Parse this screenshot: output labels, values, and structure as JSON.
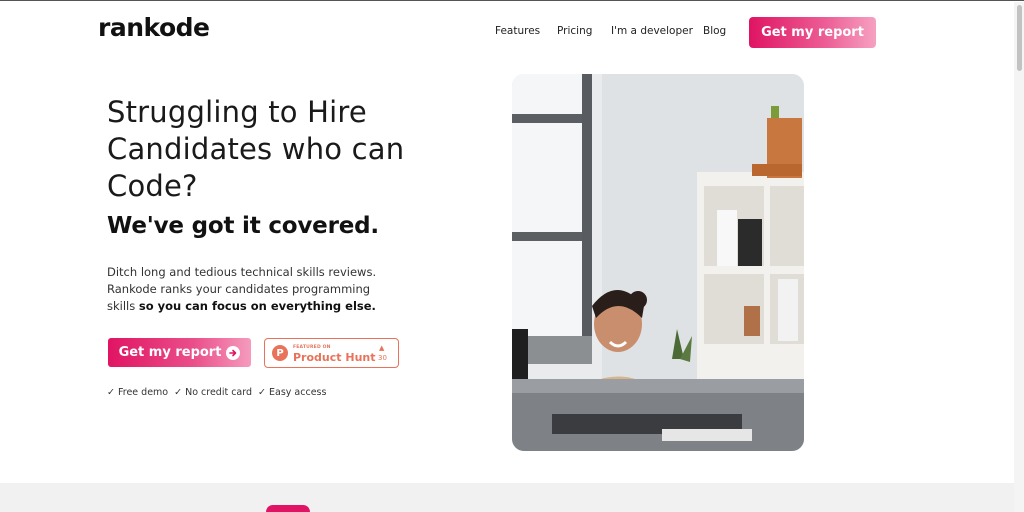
{
  "header": {
    "logo": "rankode",
    "nav": [
      "Features",
      "Pricing",
      "I'm a developer",
      "Blog"
    ],
    "cta": "Get my report"
  },
  "hero": {
    "title": "Struggling to Hire Candidates who can Code?",
    "subtitle": "We've got it covered.",
    "description_plain": "Ditch long and tedious technical skills reviews. Rankode ranks your candidates programming skills",
    "description_bold": "so you can focus on everything else.",
    "cta": "Get my report",
    "product_hunt": {
      "small": "FEATURED ON",
      "big": "Product Hunt",
      "count": "30"
    },
    "perks": [
      "✓ Free demo",
      "✓ No credit card",
      "✓ Easy access"
    ]
  },
  "colors": {
    "brand": "#e01463",
    "product_hunt": "#e8735a"
  }
}
